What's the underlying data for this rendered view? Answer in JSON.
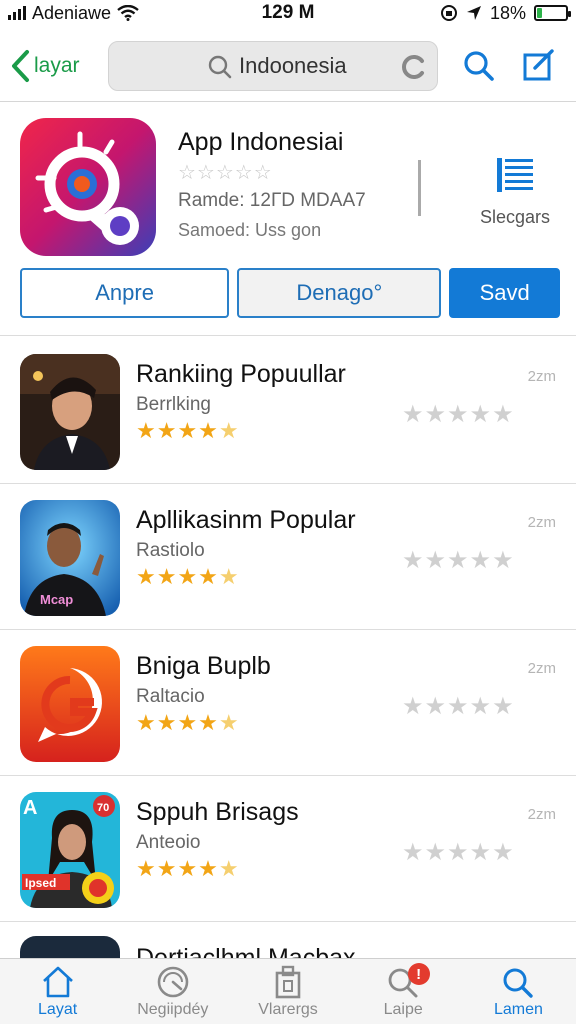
{
  "status_bar": {
    "carrier": "Adeniawe",
    "time": "129 M",
    "battery_text": "18%",
    "battery_level": 0.18,
    "battery_color": "#2db34a"
  },
  "nav": {
    "back_label": "layar",
    "back_icon": "chevron-left-icon",
    "search_value": "Indoonesia",
    "search_icon": "search-icon",
    "refresh_icon": "refresh-icon",
    "right_icons": [
      "search-icon",
      "compose-icon"
    ],
    "accent_color": "#137ad6"
  },
  "featured": {
    "title": "App Indonesiai",
    "stars": "☆☆☆☆☆",
    "meta1": "Ramde:  12ГD MDAA7",
    "meta2": "Samoed: Uss gon",
    "categories_label": "Slecgars",
    "buttons": [
      "Anpre",
      "Denago°",
      "Savd"
    ]
  },
  "list": [
    {
      "title": "Rankiing Popuullar",
      "sub": "Berrlking",
      "size": "2zm",
      "rating": 4.5
    },
    {
      "title": "Apllikasinm Popular",
      "sub": "Rastiolo",
      "size": "2zm",
      "rating": 4.5
    },
    {
      "title": "Bniga Buplb",
      "sub": "Raltacio",
      "size": "2zm",
      "rating": 4.5
    },
    {
      "title": "Sppuh Brisags",
      "sub": "Anteoio",
      "size": "2zm",
      "rating": 4.5
    }
  ],
  "partial_row_title": "Dertiaclhml Macbax",
  "tabs": [
    {
      "label": "Layat",
      "icon": "home-icon",
      "active": true
    },
    {
      "label": "Negiipdéy",
      "icon": "gauge-icon",
      "active": false
    },
    {
      "label": "Vlarergs",
      "icon": "box-icon",
      "active": false
    },
    {
      "label": "Laipe",
      "icon": "search-icon",
      "active": false,
      "badge": "!"
    },
    {
      "label": "Lamen",
      "icon": "search-icon",
      "active": true
    }
  ]
}
